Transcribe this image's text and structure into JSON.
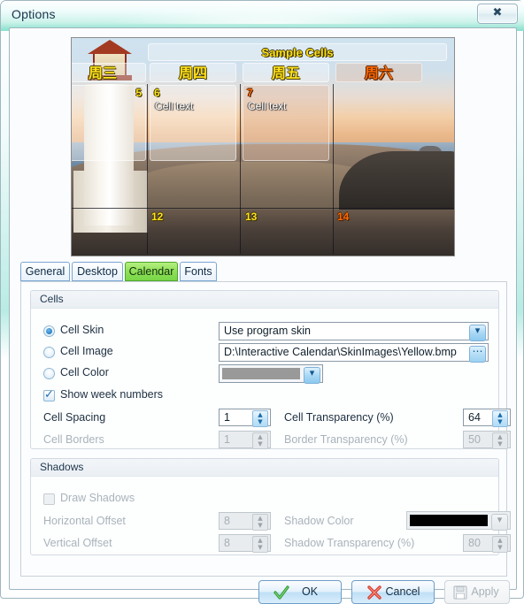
{
  "window": {
    "title": "Options",
    "close_label": "✕"
  },
  "preview": {
    "title_cell": "Sample Cells",
    "day_headers": [
      "周三",
      "周四",
      "周五",
      "周六"
    ],
    "row1": [
      {
        "num": "5",
        "text": ""
      },
      {
        "num": "6",
        "text": "Cell text"
      },
      {
        "num": "7",
        "text": "Cell text"
      }
    ],
    "row2": [
      {
        "num": "12",
        "text": ""
      },
      {
        "num": "13",
        "text": ""
      },
      {
        "num": "14",
        "text": ""
      }
    ],
    "colors": {
      "weekday_text": "#ffe21c",
      "saturday_text": "#ff6a00",
      "cell_text": "#ffffff"
    }
  },
  "tabs": [
    {
      "label": "General",
      "selected": false
    },
    {
      "label": "Desktop",
      "selected": false
    },
    {
      "label": "Calendar",
      "selected": true
    },
    {
      "label": "Fonts",
      "selected": false
    }
  ],
  "cells_group": {
    "caption": "Cells",
    "options": [
      {
        "label": "Cell Skin",
        "selected": true
      },
      {
        "label": "Cell Image",
        "selected": false
      },
      {
        "label": "Cell Color",
        "selected": false
      }
    ],
    "cell_skin_value": "Use program skin",
    "cell_image_value": "D:\\Interactive Calendar\\SkinImages\\Yellow.bmp",
    "cell_color_value": "#999999",
    "show_week_numbers": {
      "label": "Show week numbers",
      "checked": true
    },
    "cell_spacing": {
      "label": "Cell Spacing",
      "value": "1",
      "enabled": true
    },
    "cell_transparency": {
      "label": "Cell Transparency (%)",
      "value": "64",
      "enabled": true
    },
    "cell_borders": {
      "label": "Cell Borders",
      "value": "1",
      "enabled": false
    },
    "border_transparency": {
      "label": "Border Transparency (%)",
      "value": "50",
      "enabled": false
    }
  },
  "shadows_group": {
    "caption": "Shadows",
    "draw_shadows": {
      "label": "Draw Shadows",
      "checked": false
    },
    "horizontal_offset": {
      "label": "Horizontal Offset",
      "value": "8",
      "enabled": false
    },
    "vertical_offset": {
      "label": "Vertical Offset",
      "value": "8",
      "enabled": false
    },
    "shadow_color": {
      "label": "Shadow Color",
      "value": "#000000",
      "enabled": false
    },
    "shadow_transparency": {
      "label": "Shadow Transparency (%)",
      "value": "80",
      "enabled": false
    }
  },
  "buttons": {
    "ok": {
      "label": "OK",
      "enabled": true
    },
    "cancel": {
      "label": "Cancel",
      "enabled": true
    },
    "apply": {
      "label": "Apply",
      "enabled": false
    }
  }
}
